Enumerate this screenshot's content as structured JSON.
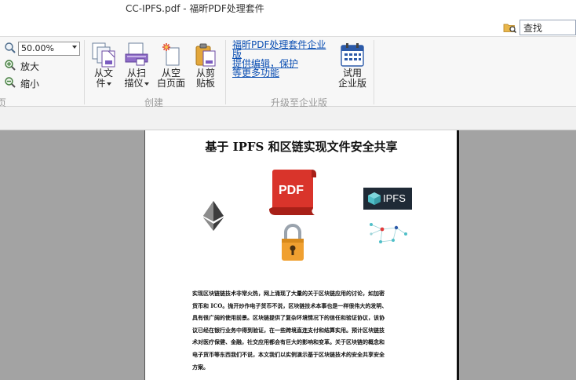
{
  "window": {
    "title": "CC-IPFS.pdf - 福昕PDF处理套件"
  },
  "search": {
    "placeholder": "查找"
  },
  "zoom": {
    "value": "50.00%",
    "zoom_in_label": "放大",
    "zoom_out_label": "缩小",
    "group_label_fragment": "页"
  },
  "create_group": {
    "label": "创建",
    "buttons": [
      {
        "line1": "从文",
        "line2": "件"
      },
      {
        "line1": "从扫",
        "line2": "描仪"
      },
      {
        "line1": "从空",
        "line2": "白页面"
      },
      {
        "line1": "从剪",
        "line2": "贴板"
      }
    ]
  },
  "upgrade_group": {
    "label": "升级至企业版",
    "link_lines": [
      "福昕PDF处理套件企业版",
      "提供编辑，保护",
      "等更多功能"
    ],
    "trial_button": {
      "line1": "试用",
      "line2": "企业版"
    }
  },
  "document": {
    "title": "基于 IPFS 和区链实现文件安全共享",
    "pdf_badge": "PDF",
    "ipfs_logo_text": "IPFS",
    "body_lines": [
      "实现区块链链技术非常火热，网上涌现了大量的关于区块链应用的讨论，如加密",
      "货币和 ICO。抛开炒作电子货币不说，区块链技术本事也是一样很伟大的发明、",
      "具有很广阔的使用前景。区块链提供了复杂环境情况下的信任和验证协议，该协",
      "议已经在银行业务中得到验证，在一些跨境直连支付和结算实用。预计区块链技",
      "术对医疗保健、金融，社交应用都会有巨大的影响和变革。关于区块链的概念和",
      "电子货币等东西我们不说，本文我们以实例演示基于区块链技术的安全共享安全",
      "方案。"
    ]
  },
  "colors": {
    "accent_link": "#0b4fb3",
    "pdf_red": "#d9342b",
    "lock_orange": "#f0a030",
    "ipfs_dark": "#1f2a36",
    "ipfs_teal": "#4fbfc8"
  }
}
